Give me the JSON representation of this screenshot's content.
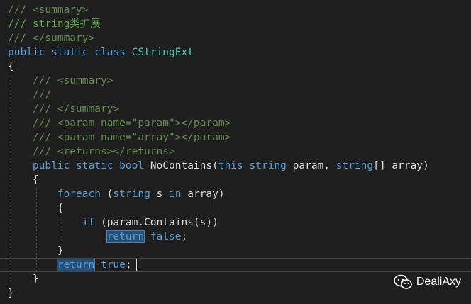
{
  "editor": {
    "lines": [
      [
        {
          "t": "/// <summary>",
          "c": "c-doc"
        }
      ],
      [
        {
          "t": "/// string类扩展",
          "c": "c-comment"
        }
      ],
      [
        {
          "t": "/// </summary>",
          "c": "c-doc"
        }
      ],
      [
        {
          "t": "public",
          "c": "c-keyword"
        },
        {
          "t": " ",
          "c": "c-plain"
        },
        {
          "t": "static",
          "c": "c-keyword"
        },
        {
          "t": " ",
          "c": "c-plain"
        },
        {
          "t": "class",
          "c": "c-keyword"
        },
        {
          "t": " ",
          "c": "c-plain"
        },
        {
          "t": "CStringExt",
          "c": "c-type"
        }
      ],
      [
        {
          "t": "{",
          "c": "c-plain"
        }
      ],
      [
        {
          "t": "    ",
          "c": "c-plain"
        },
        {
          "t": "/// <summary>",
          "c": "c-doc"
        }
      ],
      [
        {
          "t": "    ",
          "c": "c-plain"
        },
        {
          "t": "///",
          "c": "c-doc"
        }
      ],
      [
        {
          "t": "    ",
          "c": "c-plain"
        },
        {
          "t": "/// </summary>",
          "c": "c-doc"
        }
      ],
      [
        {
          "t": "    ",
          "c": "c-plain"
        },
        {
          "t": "/// <param name=\"param\"></param>",
          "c": "c-doc"
        }
      ],
      [
        {
          "t": "    ",
          "c": "c-plain"
        },
        {
          "t": "/// <param name=\"array\"></param>",
          "c": "c-doc"
        }
      ],
      [
        {
          "t": "    ",
          "c": "c-plain"
        },
        {
          "t": "/// <returns></returns>",
          "c": "c-doc"
        }
      ],
      [
        {
          "t": "    ",
          "c": "c-plain"
        },
        {
          "t": "public",
          "c": "c-keyword"
        },
        {
          "t": " ",
          "c": "c-plain"
        },
        {
          "t": "static",
          "c": "c-keyword"
        },
        {
          "t": " ",
          "c": "c-plain"
        },
        {
          "t": "bool",
          "c": "c-keyword"
        },
        {
          "t": " NoContains(",
          "c": "c-plain"
        },
        {
          "t": "this",
          "c": "c-keyword"
        },
        {
          "t": " ",
          "c": "c-plain"
        },
        {
          "t": "string",
          "c": "c-keyword"
        },
        {
          "t": " param, ",
          "c": "c-plain"
        },
        {
          "t": "string",
          "c": "c-keyword"
        },
        {
          "t": "[] array)",
          "c": "c-plain"
        }
      ],
      [
        {
          "t": "    {",
          "c": "c-plain"
        }
      ],
      [
        {
          "t": "        ",
          "c": "c-plain"
        },
        {
          "t": "foreach",
          "c": "c-keyword"
        },
        {
          "t": " (",
          "c": "c-plain"
        },
        {
          "t": "string",
          "c": "c-keyword"
        },
        {
          "t": " s ",
          "c": "c-plain"
        },
        {
          "t": "in",
          "c": "c-keyword"
        },
        {
          "t": " array)",
          "c": "c-plain"
        }
      ],
      [
        {
          "t": "        {",
          "c": "c-plain"
        }
      ],
      [
        {
          "t": "            ",
          "c": "c-plain"
        },
        {
          "t": "if",
          "c": "c-keyword"
        },
        {
          "t": " (param.Contains(s))",
          "c": "c-plain"
        }
      ],
      [
        {
          "t": "                ",
          "c": "c-plain"
        },
        {
          "t": "return",
          "c": "c-keyword",
          "hl": true
        },
        {
          "t": " ",
          "c": "c-plain"
        },
        {
          "t": "false",
          "c": "c-keyword"
        },
        {
          "t": ";",
          "c": "c-plain"
        }
      ],
      [
        {
          "t": "        }",
          "c": "c-plain"
        }
      ],
      [
        {
          "t": "        ",
          "c": "c-plain"
        },
        {
          "t": "return",
          "c": "c-keyword",
          "hl": true
        },
        {
          "t": " ",
          "c": "c-plain"
        },
        {
          "t": "true",
          "c": "c-keyword"
        },
        {
          "t": ";",
          "c": "c-plain"
        }
      ],
      [
        {
          "t": "    }",
          "c": "c-plain"
        }
      ],
      [
        {
          "t": "}",
          "c": "c-plain"
        }
      ]
    ],
    "current_line_index": 18
  },
  "watermark": {
    "label": "DealiAxy",
    "icon": "wechat-icon"
  }
}
